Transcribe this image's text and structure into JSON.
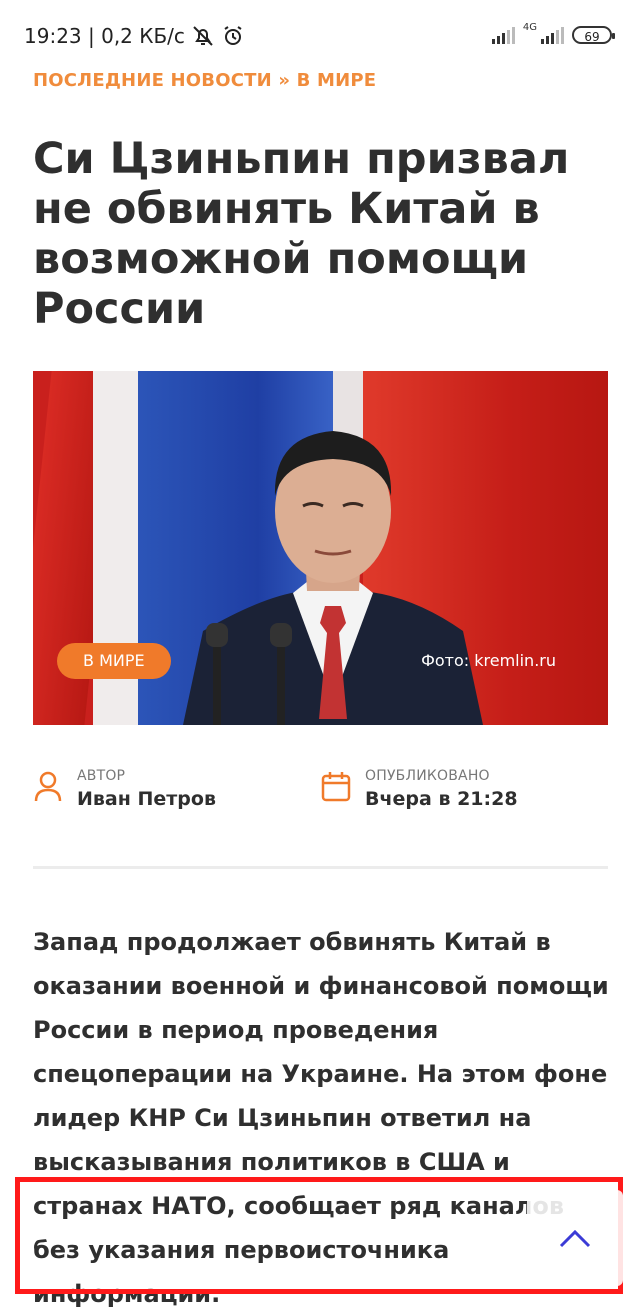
{
  "status_bar": {
    "time_speed": "19:23 | 0,2 КБ/с",
    "icons": [
      "bell-off-icon",
      "alarm-icon",
      "signal-icon",
      "4g-signal-icon"
    ],
    "network": "4G",
    "battery": "69"
  },
  "breadcrumb": "ПОСЛЕДНИЕ НОВОСТИ » В МИРЕ",
  "article": {
    "title": "Си Цзиньпин призвал не обвинять Китай в возможной помощи России",
    "image_tag": "В МИРЕ",
    "image_credit": "Фото: kremlin.ru",
    "author_label": "АВТОР",
    "author_name": "Иван Петров",
    "published_label": "ОПУБЛИКОВАНО",
    "published_value": "Вчера в 21:28",
    "lead": "Запад продолжает обвинять Китай в оказании военной и финансовой помощи России в период проведения спецоперации на Украине. На этом фоне лидер КНР Си Цзиньпин ответил на высказывания политиков в США и странах НАТО, сообщает ряд каналов без указания первоисточника информации."
  },
  "colors": {
    "accent": "#f07a2a",
    "breadcrumb": "#f08c3c",
    "highlight": "#ff1a1a",
    "scroll_icon": "#3b3bd6"
  }
}
